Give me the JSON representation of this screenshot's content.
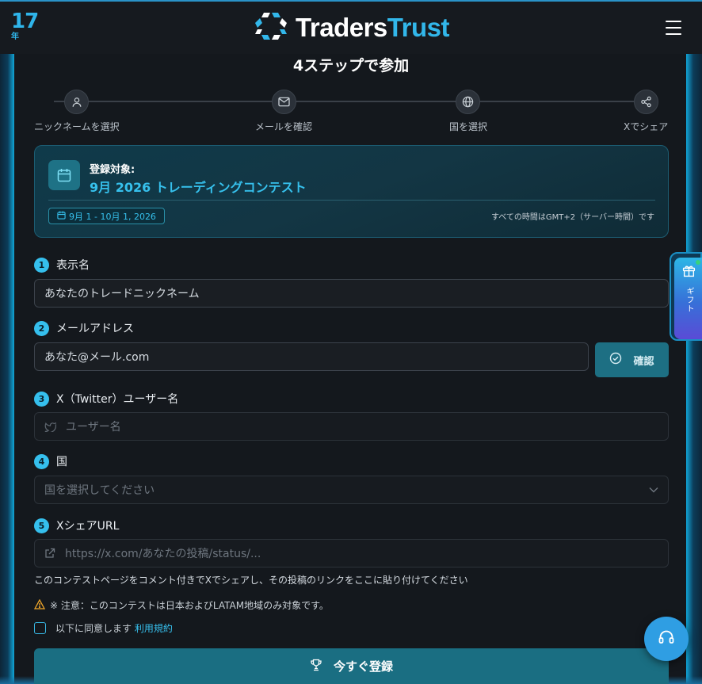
{
  "header": {
    "years_number": "17",
    "years_unit": "年",
    "brand_part1": "Traders",
    "brand_part2": "Trust"
  },
  "page": {
    "heading": "4ステップで参加"
  },
  "steps": [
    {
      "label": "ニックネームを選択",
      "icon": "user-icon"
    },
    {
      "label": "メールを確認",
      "icon": "mail-icon"
    },
    {
      "label": "国を選択",
      "icon": "globe-icon"
    },
    {
      "label": "Xでシェア",
      "icon": "share-icon"
    }
  ],
  "contest": {
    "label": "登録対象:",
    "title": "9月 2026 トレーディングコンテスト",
    "dates": "9月 1 - 10月 1, 2026",
    "timezone_note": "すべての時間はGMT+2（サーバー時間）です"
  },
  "form": {
    "display_name": {
      "num": "1",
      "label": "表示名",
      "placeholder": "あなたのトレードニックネーム"
    },
    "email": {
      "num": "2",
      "label": "メールアドレス",
      "placeholder": "あなた@メール.com",
      "confirm_label": "確認"
    },
    "twitter": {
      "num": "3",
      "label": "X（Twitter）ユーザー名",
      "placeholder": "ユーザー名"
    },
    "country": {
      "num": "4",
      "label": "国",
      "placeholder": "国を選択してください"
    },
    "share_url": {
      "num": "5",
      "label": "XシェアURL",
      "placeholder": "https://x.com/あなたの投稿/status/..."
    },
    "hint": "このコンテストページをコメント付きでXでシェアし、その投稿のリンクをここに貼り付けてください",
    "warning": "※ 注意：このコンテストは日本およびLATAM地域のみ対象です。",
    "agree_text": "以下に同意します",
    "terms_link": "利用規約",
    "submit_label": "今すぐ登録"
  },
  "widgets": {
    "gift_label": "ギフト"
  },
  "colors": {
    "accent": "#36c0ec",
    "button": "#1a6e82",
    "panel": "#14181d"
  }
}
